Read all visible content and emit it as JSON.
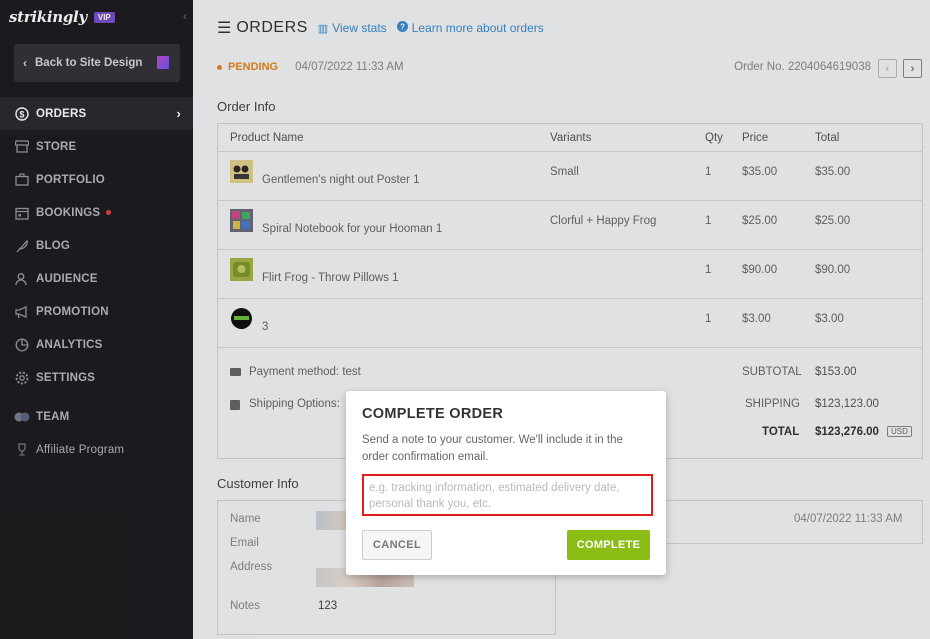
{
  "sidebar": {
    "logo": "strikingly",
    "badge": "VIP",
    "back_label": "Back to Site Design",
    "items": [
      {
        "label": "ORDERS",
        "icon": "dollar-circle-icon"
      },
      {
        "label": "STORE",
        "icon": "store-icon"
      },
      {
        "label": "PORTFOLIO",
        "icon": "briefcase-icon"
      },
      {
        "label": "BOOKINGS",
        "icon": "calendar-icon"
      },
      {
        "label": "BLOG",
        "icon": "feather-icon"
      },
      {
        "label": "AUDIENCE",
        "icon": "users-icon"
      },
      {
        "label": "PROMOTION",
        "icon": "megaphone-icon"
      },
      {
        "label": "ANALYTICS",
        "icon": "pie-chart-icon"
      },
      {
        "label": "SETTINGS",
        "icon": "gear-icon"
      },
      {
        "label": "TEAM",
        "icon": "team-icon"
      },
      {
        "label": "Affiliate Program",
        "icon": "trophy-icon"
      }
    ]
  },
  "header": {
    "title": "ORDERS",
    "view_stats": "View stats",
    "learn_more": "Learn more about orders"
  },
  "order": {
    "status": "PENDING",
    "date": "04/07/2022 11:33 AM",
    "order_no": "Order No. 2204064619038"
  },
  "order_info": {
    "title": "Order Info",
    "columns": [
      "Product Name",
      "Variants",
      "Qty",
      "Price",
      "Total"
    ],
    "rows": [
      {
        "name": "Gentlemen's night out Poster 1",
        "variant": "Small",
        "qty": "1",
        "price": "$35.00",
        "total": "$35.00"
      },
      {
        "name": "Spiral Notebook for your Hooman 1",
        "variant": "Clorful + Happy Frog",
        "qty": "1",
        "price": "$25.00",
        "total": "$25.00"
      },
      {
        "name": "Flirt Frog - Throw Pillows 1",
        "variant": "",
        "qty": "1",
        "price": "$90.00",
        "total": "$90.00"
      },
      {
        "name": "3",
        "variant": "",
        "qty": "1",
        "price": "$3.00",
        "total": "$3.00"
      }
    ],
    "payment_method": "Payment method: test",
    "shipping_options": "Shipping Options:",
    "subtotal_label": "SUBTOTAL",
    "subtotal": "$153.00",
    "shipping_label": "SHIPPING",
    "shipping": "$123,123.00",
    "total_label": "TOTAL",
    "total": "$123,276.00",
    "currency": "USD"
  },
  "customer_info": {
    "title": "Customer Info",
    "name_label": "Name",
    "email_label": "Email",
    "address_label": "Address",
    "notes_label": "Notes",
    "notes": "123"
  },
  "history": {
    "date": "04/07/2022 11:33 AM"
  },
  "modal": {
    "title": "COMPLETE ORDER",
    "description": "Send a note to your customer. We'll include it in the order confirmation email.",
    "placeholder": "e.g. tracking information, estimated delivery date, personal thank you, etc.",
    "value": "",
    "cancel": "CANCEL",
    "complete": "COMPLETE"
  },
  "colors": {
    "accent": "#8bbd14",
    "pending": "#e4871d",
    "link": "#3a8bd1",
    "highlight": "#e01d1d"
  }
}
